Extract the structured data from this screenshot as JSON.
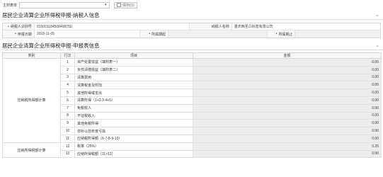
{
  "toolbar": {
    "select_label": "主附表单",
    "save_label": "保存(S)"
  },
  "section1": {
    "title": "居民企业清算企业所得税申报-纳税人信息",
    "taxpayer_id_label": "纳税人识别号",
    "taxpayer_id_value": "91500118450846875D",
    "taxpayer_name_label": "纳税人名称",
    "taxpayer_name_value": "重庆西圣凸标签有限公司",
    "declare_date_label": "申报日期",
    "declare_date_value": "2018-11-05",
    "period_start_label": "所属期起",
    "period_end_label": "所属期止"
  },
  "section2": {
    "title": "居民企业清算企业所得税申报-申报表信息",
    "headers": [
      "类别",
      "行次",
      "项目",
      "金额"
    ],
    "category_main": "应纳税所得额计算",
    "category_tax": "应纳所得税额计算",
    "rows": [
      {
        "no": "1",
        "item": "资产处置损益（填附表一）",
        "amount": "0.00"
      },
      {
        "no": "2",
        "item": "负债清偿损益（填附表二）",
        "amount": "0.00"
      },
      {
        "no": "3",
        "item": "清算费用",
        "amount": "0.00"
      },
      {
        "no": "4",
        "item": "清算税金及附加",
        "amount": "0.00"
      },
      {
        "no": "5",
        "item": "其他所得或支出",
        "amount": "0.00"
      },
      {
        "no": "6",
        "item": "清算所得（1+2-3-4+5）",
        "amount": "0.00"
      },
      {
        "no": "7",
        "item": "免税收入",
        "amount": "0.00"
      },
      {
        "no": "8",
        "item": "不征税收入",
        "amount": "0.00"
      },
      {
        "no": "9",
        "item": "其他免税所得",
        "amount": "0.00"
      },
      {
        "no": "10",
        "item": "弥补以前年度亏损",
        "amount": "0.00"
      },
      {
        "no": "11",
        "item": "应纳税所得额（6-7-8-9-10）",
        "amount": "0.00"
      },
      {
        "no": "12",
        "item": "税率（25%）",
        "amount": "0.25"
      },
      {
        "no": "13",
        "item": "应纳所得税额（11×12）",
        "amount": "0.00"
      }
    ]
  }
}
